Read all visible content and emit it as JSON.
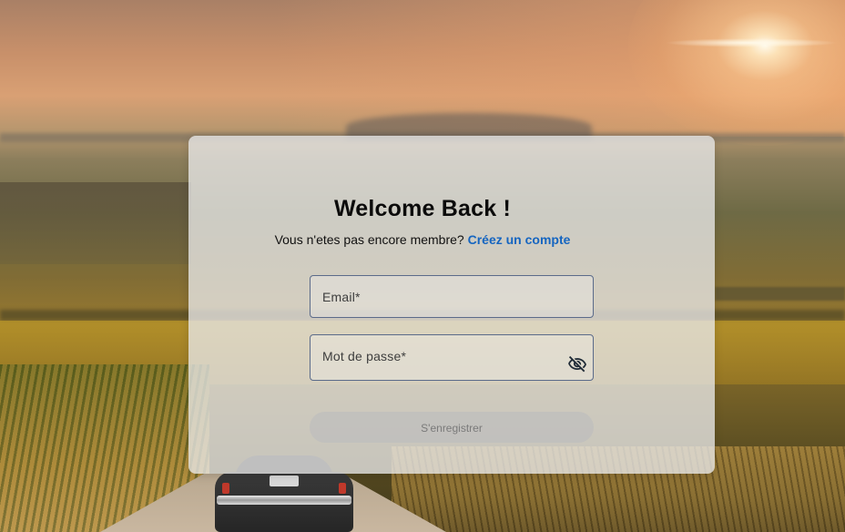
{
  "login_card": {
    "title": "Welcome Back !",
    "subtitle_text": "Vous n'etes pas encore membre?",
    "signup_link": "Créez un compte"
  },
  "form": {
    "email_label": "Email*",
    "email_value": "",
    "password_label": "Mot de passe*",
    "password_value": "",
    "password_toggle_icon": "eye-off-icon",
    "submit_label": "S'enregistrer",
    "submit_enabled": false
  },
  "colors": {
    "link": "#1565c0",
    "field_border": "#5b6b8a"
  }
}
